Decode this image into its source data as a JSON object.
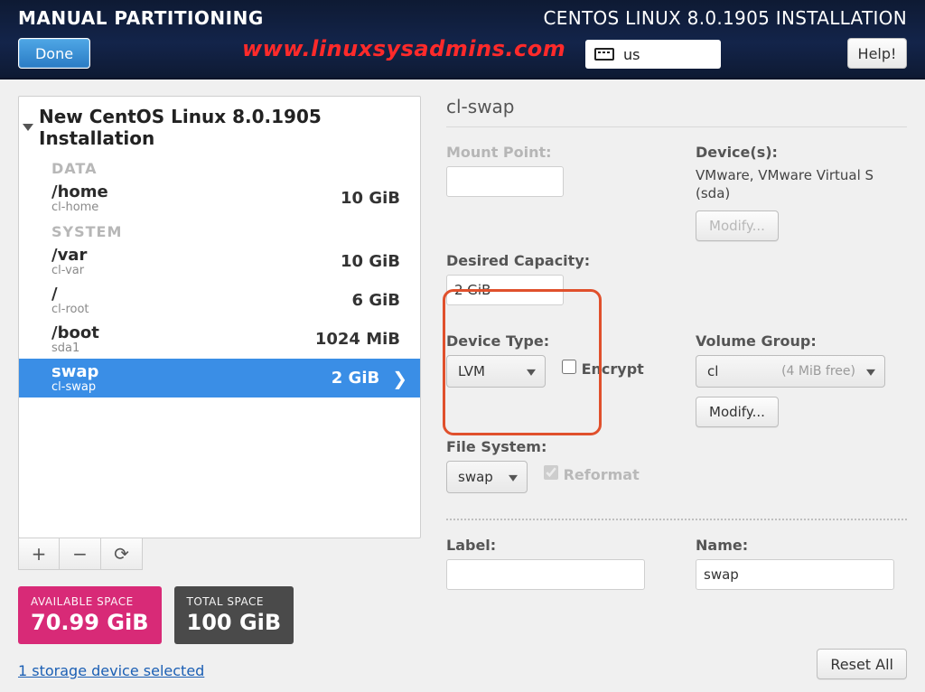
{
  "header": {
    "title_left": "MANUAL PARTITIONING",
    "title_right": "CENTOS LINUX 8.0.1905 INSTALLATION",
    "done_label": "Done",
    "help_label": "Help!",
    "watermark": "www.linuxsysadmins.com",
    "keyboard_layout": "us"
  },
  "tree": {
    "heading": "New CentOS Linux 8.0.1905 Installation",
    "categories": [
      {
        "label": "DATA",
        "items": [
          {
            "mount": "/home",
            "device": "cl-home",
            "size": "10 GiB",
            "selected": false
          }
        ]
      },
      {
        "label": "SYSTEM",
        "items": [
          {
            "mount": "/var",
            "device": "cl-var",
            "size": "10 GiB",
            "selected": false
          },
          {
            "mount": "/",
            "device": "cl-root",
            "size": "6 GiB",
            "selected": false
          },
          {
            "mount": "/boot",
            "device": "sda1",
            "size": "1024 MiB",
            "selected": false
          },
          {
            "mount": "swap",
            "device": "cl-swap",
            "size": "2 GiB",
            "selected": true
          }
        ]
      }
    ]
  },
  "toolbar": {
    "add": "+",
    "remove": "−",
    "reload": "⟳"
  },
  "space": {
    "available_label": "AVAILABLE SPACE",
    "available_value": "70.99 GiB",
    "total_label": "TOTAL SPACE",
    "total_value": "100 GiB"
  },
  "storage_link": "1 storage device selected",
  "details": {
    "title": "cl-swap",
    "mount_point_label": "Mount Point:",
    "mount_point_value": "",
    "desired_capacity_label": "Desired Capacity:",
    "desired_capacity_value": "2 GiB",
    "devices_label": "Device(s):",
    "devices_text": "VMware, VMware Virtual S (sda)",
    "modify_label": "Modify...",
    "device_type_label": "Device Type:",
    "device_type_value": "LVM",
    "encrypt_label": "Encrypt",
    "filesystem_label": "File System:",
    "filesystem_value": "swap",
    "reformat_label": "Reformat",
    "volume_group_label": "Volume Group:",
    "volume_group_value": "cl",
    "volume_group_free": "(4 MiB free)",
    "vg_modify_label": "Modify...",
    "label_label": "Label:",
    "label_value": "",
    "name_label": "Name:",
    "name_value": "swap"
  },
  "reset_all_label": "Reset All"
}
